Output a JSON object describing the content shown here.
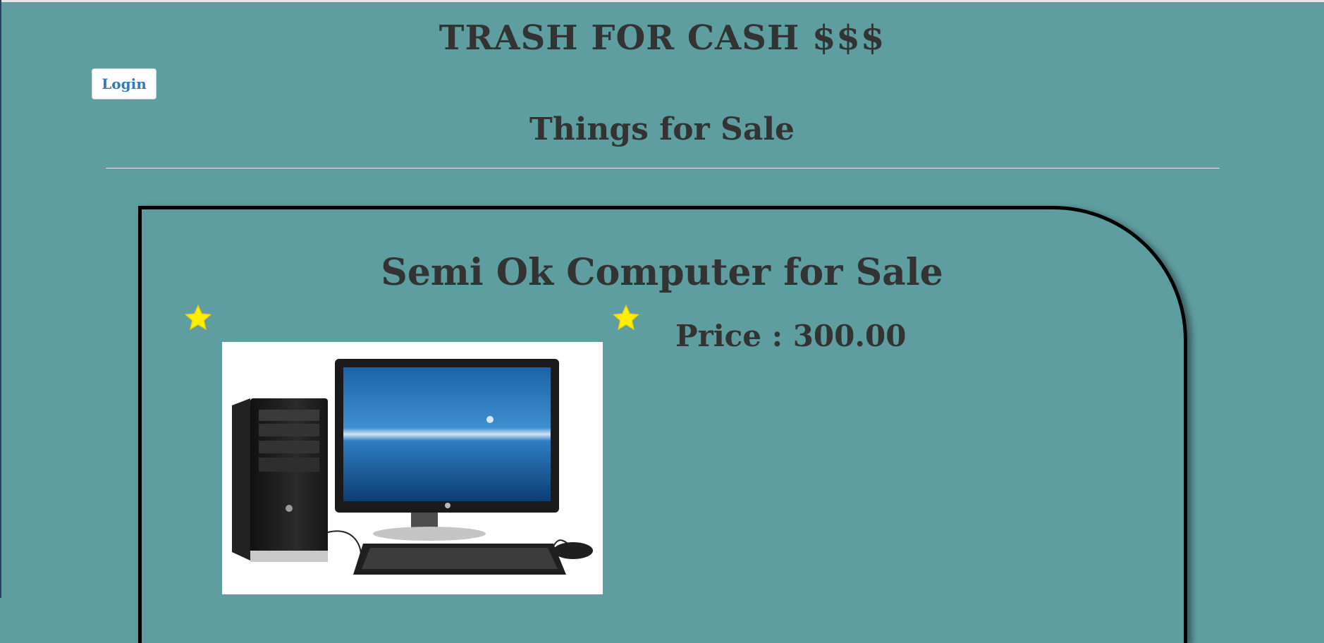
{
  "site": {
    "title": "TRASH FOR CASH $$$"
  },
  "header": {
    "login_label": "Login"
  },
  "section": {
    "title": "Things for Sale"
  },
  "listing": {
    "title": "Semi Ok Computer for Sale",
    "price_text": "Price : 300.00"
  },
  "colors": {
    "background": "#5f9ea0",
    "text": "#333333",
    "star": "#ffee00",
    "link": "#337ab7"
  },
  "icons": {
    "star": "star-icon",
    "product": "desktop-computer-image"
  }
}
